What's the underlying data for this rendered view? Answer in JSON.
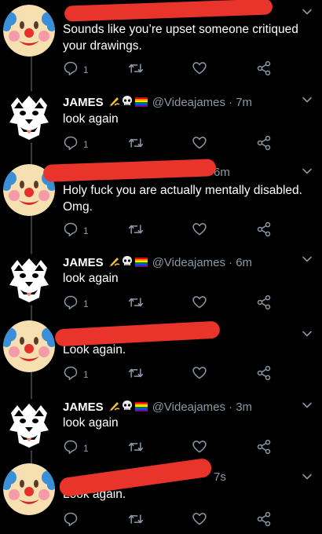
{
  "tweets": [
    {
      "kind": "clown",
      "text": "Sounds like you’re upset someone critiqued your drawings.",
      "time": "",
      "reply_count": "1"
    },
    {
      "kind": "james",
      "name": "JAMES",
      "handle": "@Videajames",
      "time": "· 7m",
      "text": "look again",
      "reply_count": "1"
    },
    {
      "kind": "clown",
      "text": "Holy fuck you are actually mentally disabled. Omg.",
      "time": "6m",
      "reply_count": "1"
    },
    {
      "kind": "james",
      "name": "JAMES",
      "handle": "@Videajames",
      "time": "· 6m",
      "text": "look again",
      "reply_count": "1"
    },
    {
      "kind": "clown",
      "text": "Look again.",
      "time": "",
      "reply_count": "1"
    },
    {
      "kind": "james",
      "name": "JAMES",
      "handle": "@Videajames",
      "time": "· 3m",
      "text": "look again",
      "reply_count": "1"
    },
    {
      "kind": "clown",
      "text": "Look again.",
      "time": "7s",
      "reply_count": ""
    }
  ],
  "icons": {
    "reply": "reply-icon",
    "retweet": "retweet-icon",
    "like": "heart-icon",
    "share": "share-icon",
    "more": "chevron-down-icon"
  },
  "colors": {
    "background": "#000000",
    "muted": "#8b98a5",
    "redaction": "#e8342a"
  }
}
